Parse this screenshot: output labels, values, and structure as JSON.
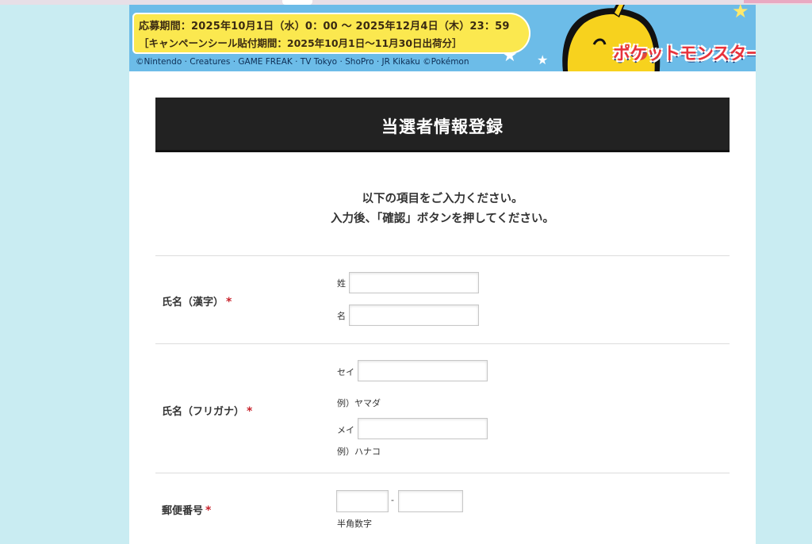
{
  "banner": {
    "period_line1": "応募期間：2025年10月1日（水）0：00 ～ 2025年12月4日（木）23：59",
    "period_line2": "［キャンペーンシール貼付期間：2025年10月1日～11月30日出荷分］",
    "copyright": "©Nintendo · Creatures · GAME FREAK · TV Tokyo · ShoPro · JR Kikaku ©Pokémon",
    "logo": "ポケットモンスター"
  },
  "header": {
    "title": "当選者情報登録"
  },
  "intro": {
    "line1": "以下の項目をご入力ください。",
    "line2": "入力後、「確認」ボタンを押してください。"
  },
  "form": {
    "required_mark": "*",
    "kanji_name": {
      "label": "氏名（漢字）",
      "sei_label": "姓",
      "mei_label": "名",
      "sei_value": "",
      "mei_value": ""
    },
    "kana_name": {
      "label": "氏名（フリガナ）",
      "sei_label": "セイ",
      "mei_label": "メイ",
      "sei_example": "例）ヤマダ",
      "mei_example": "例）ハナコ",
      "sei_value": "",
      "mei_value": ""
    },
    "postal": {
      "label": "郵便番号",
      "separator": "-",
      "note": "半角数字",
      "part1_value": "",
      "part2_value": ""
    }
  },
  "colors": {
    "page_background": "#c9ecf2",
    "title_bar": "#222222",
    "required": "#c8232c",
    "banner_yellow": "#fbe84f",
    "banner_blue": "#6cbce8"
  },
  "icons": [
    "star-icon",
    "pikachu-illustration"
  ]
}
